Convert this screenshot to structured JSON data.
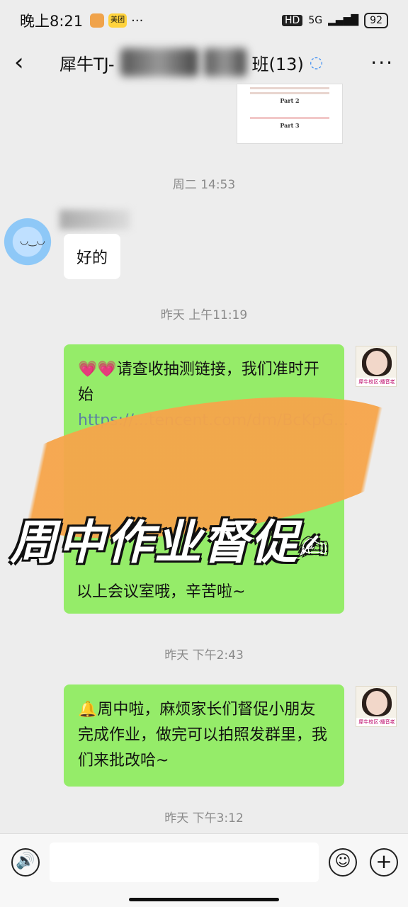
{
  "status": {
    "time": "晚上8:21",
    "hd": "HD",
    "net": "5G",
    "battery": "92",
    "app1": "美团"
  },
  "header": {
    "back": "‹",
    "title_prefix": "犀牛TJ-",
    "title_suffix": "班(13)",
    "more": "···"
  },
  "shared_image": {
    "part2": "Part 2",
    "part3": "Part 3"
  },
  "messages": [
    {
      "type": "timestamp",
      "text": "周二 14:53"
    },
    {
      "type": "incoming",
      "text": "好的"
    },
    {
      "type": "timestamp",
      "text": "昨天 上午11:19"
    },
    {
      "type": "outgoing",
      "text": "💗💗请查收抽测链接，我们准时开始",
      "link": "https://...tencent.com/dm/BcKpG...",
      "extra": "以上会议室哦，辛苦啦~"
    },
    {
      "type": "timestamp",
      "text": "昨天 下午2:43"
    },
    {
      "type": "outgoing",
      "text": "🔔周中啦，麻烦家长们督促小朋友完成作业，做完可以拍照发群里，我们来批改哈~"
    },
    {
      "type": "timestamp",
      "text": "昨天 下午3:12"
    }
  ],
  "overlay": {
    "text": "周中作业督促",
    "icon": "✍"
  },
  "avatar": {
    "caption": "犀牛校区·播音老师·张老师"
  },
  "inputbar": {
    "voice": "🔊",
    "emoji": "☺",
    "plus": "+"
  }
}
